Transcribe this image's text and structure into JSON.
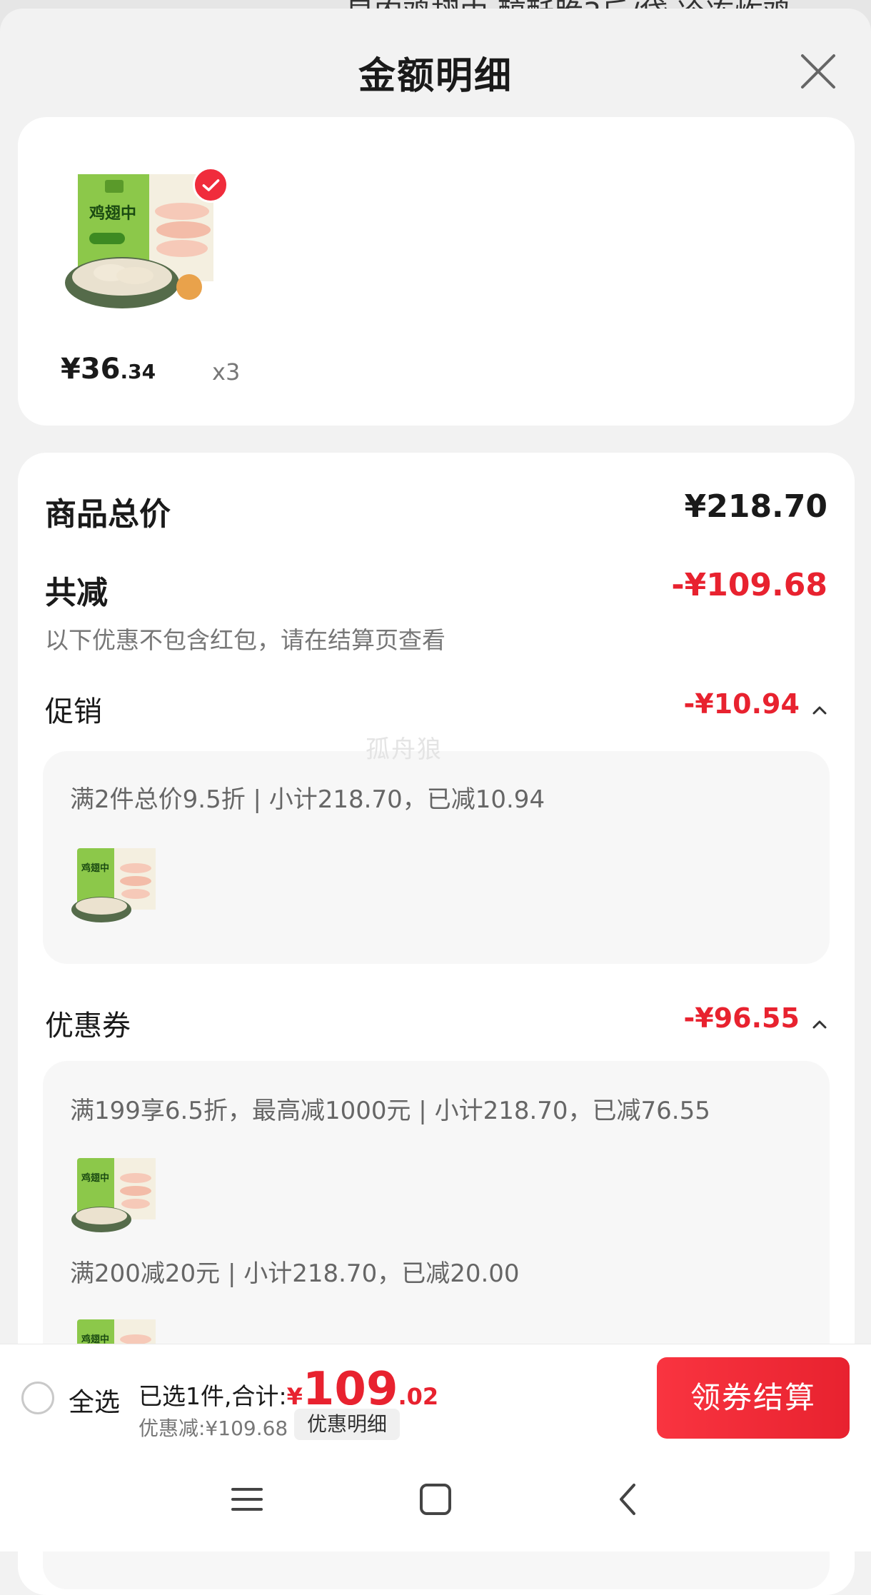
{
  "background": {
    "peek_text": "星农鸡翅中 醇酥脆3斤/袋 冷冻炸鸡"
  },
  "sheet": {
    "title": "金额明细",
    "close_icon": "close-icon"
  },
  "product": {
    "image_icon": "chicken-wing-package-image",
    "image_text": "鸡翅中",
    "price_main": "¥36",
    "price_decimal": ".34",
    "quantity": "x3"
  },
  "details": {
    "total_label": "商品总价",
    "total_value": "¥218.70",
    "discount_label": "共减",
    "discount_value": "-¥109.68",
    "note": "以下优惠不包含红包，请在结算页查看",
    "promo": {
      "label": "促销",
      "value": "-¥10.94",
      "rule": "满2件总价9.5折 | 小计218.70，已减10.94"
    },
    "coupon": {
      "label": "优惠券",
      "value": "-¥96.55",
      "rules": [
        "满199享6.5折，最高减1000元 | 小计218.70，已减76.55",
        "满200减20元 | 小计218.70，已减20.00"
      ]
    },
    "watermark": "孤舟狼"
  },
  "bottom": {
    "select_all": "全选",
    "summary_prefix": "已选1件,合计:",
    "yen": "¥",
    "total_int": "109",
    "total_dec": ".02",
    "saved": "优惠减:¥109.68",
    "detail_button": "优惠明细",
    "checkout_button": "领券结算"
  },
  "nav": {
    "menu_icon": "menu-icon",
    "home_icon": "home-square-icon",
    "back_icon": "back-icon"
  },
  "colors": {
    "accent_red": "#e8222f",
    "background": "#f2f2f2",
    "card": "#ffffff"
  }
}
